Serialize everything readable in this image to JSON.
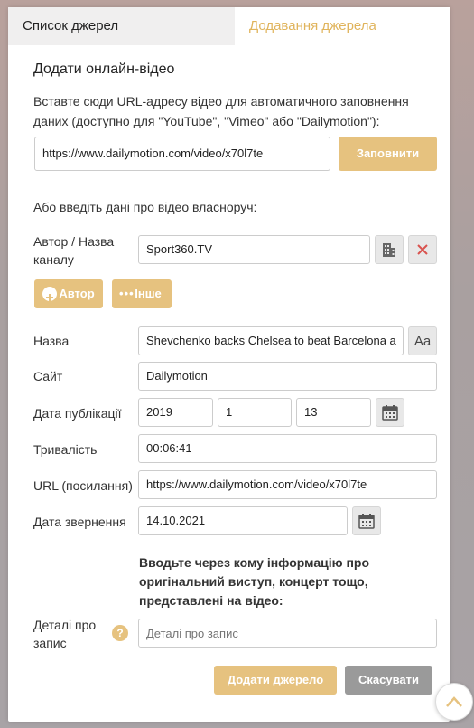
{
  "tabs": {
    "list": "Список джерел",
    "add": "Додавання джерела"
  },
  "title": "Додати онлайн-відео",
  "intro": "Вставте сюди URL-адресу відео для автоматичного заповнення даних (доступно для \"YouTube\", \"Vimeo\" або \"Dailymotion\"):",
  "url_fill": {
    "value": "https://www.dailymotion.com/video/x70l7te",
    "button": "Заповнити"
  },
  "manual_hint": "Або введіть дані про відео власноруч:",
  "author": {
    "label": "Автор / Назва каналу",
    "value": "Sport360.TV"
  },
  "add_author_button": "Автор",
  "other_button": "Інше",
  "fields": {
    "name": {
      "label": "Назва",
      "value": "Shevchenko backs Chelsea to beat Barcelona a"
    },
    "site": {
      "label": "Сайт",
      "value": "Dailymotion"
    },
    "pub_date": {
      "label": "Дата публікації",
      "year": "2019",
      "month": "1",
      "day": "13"
    },
    "duration": {
      "label": "Тривалість",
      "value": "00:06:41"
    },
    "url": {
      "label": "URL (посилання)",
      "value": "https://www.dailymotion.com/video/x70l7te"
    },
    "access_date": {
      "label": "Дата звернення",
      "value": "14.10.2021"
    }
  },
  "note": "Вводьте через кому інформацію про оригінальний виступ, концерт тощо, представлені на відео:",
  "details": {
    "label": "Деталі про запис",
    "placeholder": "Деталі про запис"
  },
  "actions": {
    "submit": "Додати джерело",
    "cancel": "Скасувати"
  },
  "colors": {
    "accent": "#e6c27f",
    "tab_active_text": "#e0b45c",
    "cancel": "#9a9a9a",
    "danger": "#d9534f"
  }
}
